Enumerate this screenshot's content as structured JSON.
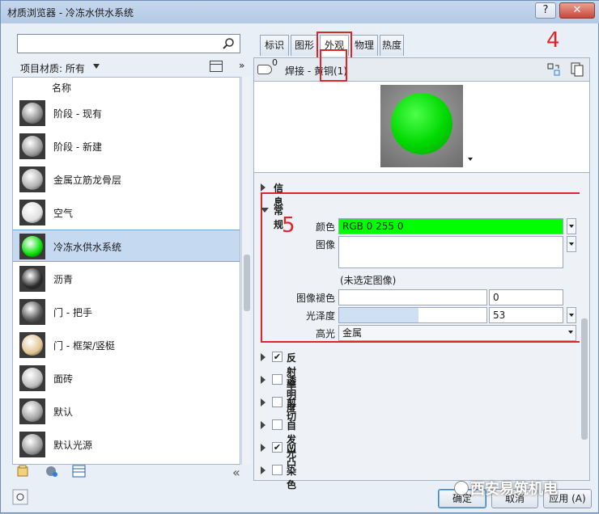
{
  "window": {
    "title": "材质浏览器 - 冷冻水供水系统",
    "help_label": "?",
    "close_label": "✕"
  },
  "search": {
    "value": "",
    "placeholder": ""
  },
  "filter": {
    "label": "项目材质: 所有",
    "more_label": "»"
  },
  "list": {
    "header": "名称",
    "items": [
      {
        "label": "阶段 - 现有",
        "ball_color": "#8a8a8a",
        "selected": false
      },
      {
        "label": "阶段 - 新建",
        "ball_color": "#9a9a9a",
        "selected": false
      },
      {
        "label": "金属立筋龙骨层",
        "ball_color": "#b0b0b0",
        "selected": false
      },
      {
        "label": "空气",
        "ball_color": "#e0e0e0",
        "selected": false
      },
      {
        "label": "冷冻水供水系统",
        "ball_color": "#00e000",
        "selected": true
      },
      {
        "label": "沥青",
        "ball_color": "#2a2a2a",
        "selected": false
      },
      {
        "label": "门 - 把手",
        "ball_color": "#555555",
        "selected": false
      },
      {
        "label": "门 - 框架/竖梃",
        "ball_color": "#e1c48f",
        "selected": false
      },
      {
        "label": "面砖",
        "ball_color": "#bdbdbd",
        "selected": false
      },
      {
        "label": "默认",
        "ball_color": "#a0a0a0",
        "selected": false
      },
      {
        "label": "默认光源",
        "ball_color": "#9a9a9a",
        "selected": false
      }
    ]
  },
  "tabs": [
    {
      "label": "标识",
      "active": false
    },
    {
      "label": "图形",
      "active": false
    },
    {
      "label": "外观",
      "active": true
    },
    {
      "label": "物理",
      "active": false
    },
    {
      "label": "热度",
      "active": false
    }
  ],
  "annotations": {
    "num4": "4",
    "num5": "5"
  },
  "asset": {
    "count": "0",
    "name": "焊接 - 黄铜(1)"
  },
  "sections": {
    "info": "信息",
    "general": "常规",
    "reflectivity": "反射率",
    "transparency": "透明度",
    "cutout": "剪切",
    "self_illumination": "自发光",
    "bump": "凹凸",
    "tint": "染色"
  },
  "general": {
    "color_label": "颜色",
    "color_value": "RGB 0 255 0",
    "color_swatch": "#00ff00",
    "image_label": "图像",
    "image_note": "(未选定图像)",
    "image_fade_label": "图像褪色",
    "image_fade_value": "0",
    "glossiness_label": "光泽度",
    "glossiness_value": "53",
    "glossiness_fraction": 0.53,
    "highlight_label": "高光",
    "highlight_value": "金属"
  },
  "checks": {
    "reflectivity": true,
    "transparency": false,
    "cutout": false,
    "self_illumination": false,
    "bump": true,
    "tint": false
  },
  "buttons": {
    "ok": "确定",
    "cancel": "取消",
    "apply": "应用 (A)"
  },
  "watermark": "西安易筑机电"
}
